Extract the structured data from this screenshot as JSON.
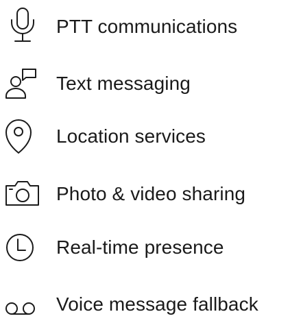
{
  "features": [
    {
      "label": "PTT communications",
      "icon": "microphone-icon"
    },
    {
      "label": "Text messaging",
      "icon": "user-chat-icon"
    },
    {
      "label": "Location services",
      "icon": "location-pin-icon"
    },
    {
      "label": "Photo & video sharing",
      "icon": "camera-icon"
    },
    {
      "label": "Real-time presence",
      "icon": "clock-icon"
    },
    {
      "label": "Voice message fallback",
      "icon": "voicemail-icon"
    }
  ],
  "colors": {
    "text": "#1a1a1a",
    "background": "#ffffff"
  }
}
